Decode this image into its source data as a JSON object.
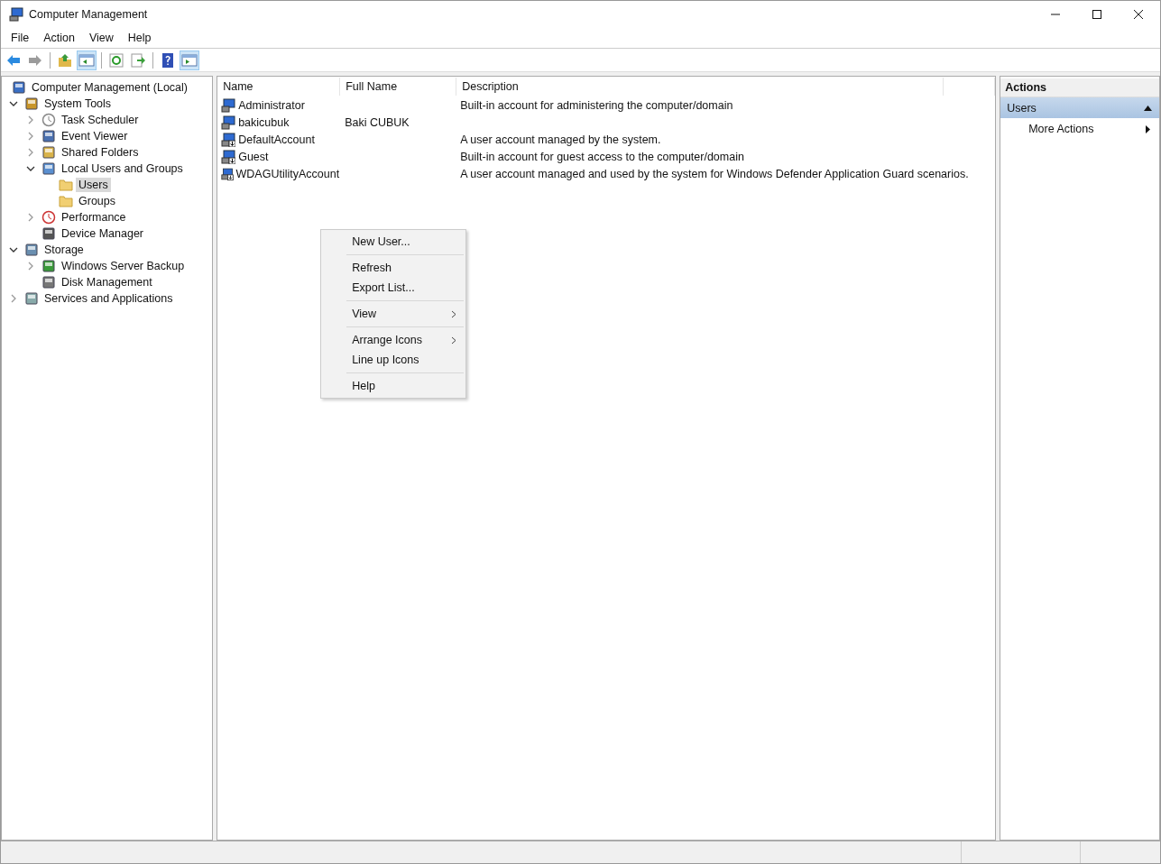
{
  "window": {
    "title": "Computer Management"
  },
  "menu_bar": [
    "File",
    "Action",
    "View",
    "Help"
  ],
  "toolbar": [
    {
      "kind": "back",
      "on": false,
      "disabled": false
    },
    {
      "kind": "forward",
      "on": false,
      "disabled": true
    },
    {
      "kind": "up",
      "on": false,
      "disabled": false
    },
    {
      "kind": "tree-pane",
      "on": true,
      "disabled": false
    },
    {
      "kind": "refresh",
      "on": false,
      "disabled": false
    },
    {
      "kind": "export",
      "on": false,
      "disabled": false
    },
    {
      "kind": "help",
      "on": false,
      "disabled": false
    },
    {
      "kind": "action-pane",
      "on": true,
      "disabled": false
    }
  ],
  "tree": [
    {
      "label": "Computer Management (Local)",
      "kind": "computer",
      "selected": false,
      "children": [
        {
          "label": "System Tools",
          "kind": "tools",
          "expanded": true,
          "selected": false,
          "children": [
            {
              "label": "Task Scheduler",
              "kind": "clock",
              "expanded": false,
              "selected": false
            },
            {
              "label": "Event Viewer",
              "kind": "log",
              "expanded": false,
              "selected": false
            },
            {
              "label": "Shared Folders",
              "kind": "share",
              "expanded": false,
              "selected": false
            },
            {
              "label": "Local Users and Groups",
              "kind": "users",
              "expanded": true,
              "selected": false,
              "children": [
                {
                  "label": "Users",
                  "kind": "folder",
                  "selected": true
                },
                {
                  "label": "Groups",
                  "kind": "folder",
                  "selected": false
                }
              ]
            },
            {
              "label": "Performance",
              "kind": "gauge",
              "expanded": false,
              "selected": false
            },
            {
              "label": "Device Manager",
              "kind": "device",
              "selected": false
            }
          ]
        },
        {
          "label": "Storage",
          "kind": "storage",
          "expanded": true,
          "selected": false,
          "children": [
            {
              "label": "Windows Server Backup",
              "kind": "backup",
              "expanded": false,
              "selected": false
            },
            {
              "label": "Disk Management",
              "kind": "disk",
              "selected": false
            }
          ]
        },
        {
          "label": "Services and Applications",
          "kind": "services",
          "expanded": false,
          "selected": false
        }
      ]
    }
  ],
  "table": {
    "columns": [
      "Name",
      "Full Name",
      "Description"
    ],
    "rows": [
      {
        "kind": "user",
        "name": "Administrator",
        "description": "Built-in account for administering the computer/domain"
      },
      {
        "kind": "user",
        "name": "bakicubuk",
        "full_name": "Baki CUBUK"
      },
      {
        "kind": "disabled-user",
        "name": "DefaultAccount",
        "description": "A user account managed by the system."
      },
      {
        "kind": "disabled-user",
        "name": "Guest",
        "description": "Built-in account for guest access to the computer/domain"
      },
      {
        "kind": "disabled-user",
        "name": "WDAGUtilityAccount",
        "description": "A user account managed and used by the system for Windows Defender Application Guard scenarios."
      }
    ]
  },
  "context_menu": [
    [
      {
        "label": "New User...",
        "submenu": false
      }
    ],
    [
      {
        "label": "Refresh",
        "submenu": false
      },
      {
        "label": "Export List...",
        "submenu": false
      }
    ],
    [
      {
        "label": "View",
        "submenu": true
      }
    ],
    [
      {
        "label": "Arrange Icons",
        "submenu": true
      },
      {
        "label": "Line up Icons",
        "submenu": false
      }
    ],
    [
      {
        "label": "Help",
        "submenu": false
      }
    ]
  ],
  "actions_pane": {
    "title": "Actions",
    "section": {
      "label": "Users",
      "expanded": true
    },
    "items": [
      {
        "label": "More Actions",
        "submenu": true
      }
    ]
  }
}
